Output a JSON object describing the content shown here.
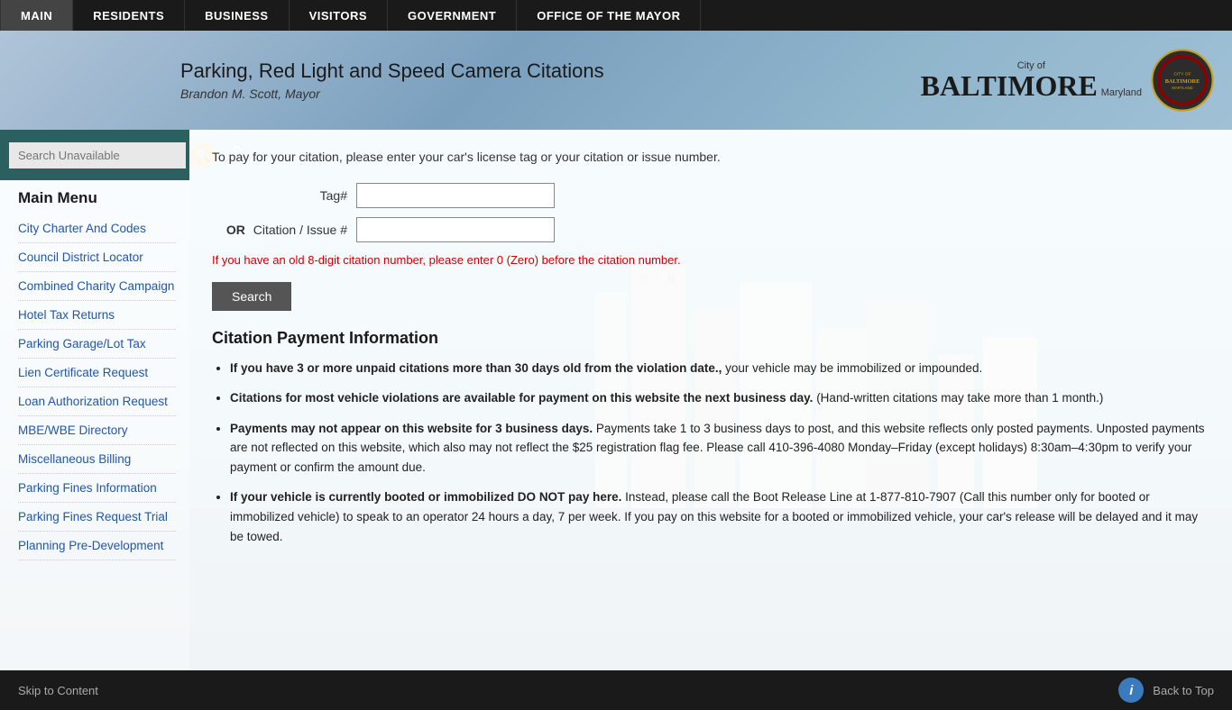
{
  "nav": {
    "items": [
      {
        "label": "MAIN",
        "active": true
      },
      {
        "label": "RESIDENTS",
        "active": false
      },
      {
        "label": "BUSINESS",
        "active": false
      },
      {
        "label": "VISITORS",
        "active": false
      },
      {
        "label": "GOVERNMENT",
        "active": false
      },
      {
        "label": "OFFICE OF THE MAYOR",
        "active": false
      }
    ]
  },
  "header": {
    "title": "Parking, Red Light and Speed Camera Citations",
    "subtitle": "Brandon M. Scott, Mayor",
    "city_of": "City of",
    "city_name": "BALTIMORE",
    "state": "Maryland"
  },
  "sidebar": {
    "search_placeholder": "Search Unavailable",
    "menu_title": "Main Menu",
    "items": [
      {
        "label": "City Charter And Codes"
      },
      {
        "label": "Council District Locator"
      },
      {
        "label": "Combined Charity Campaign"
      },
      {
        "label": "Hotel Tax Returns"
      },
      {
        "label": "Parking Garage/Lot Tax"
      },
      {
        "label": "Lien Certificate Request"
      },
      {
        "label": "Loan Authorization Request"
      },
      {
        "label": "MBE/WBE Directory"
      },
      {
        "label": "Miscellaneous Billing"
      },
      {
        "label": "Parking Fines Information"
      },
      {
        "label": "Parking Fines Request Trial"
      },
      {
        "label": "Planning Pre-Development"
      }
    ]
  },
  "form": {
    "intro": "To pay for your citation, please enter your car's license tag or your citation or issue number.",
    "tag_label": "Tag#",
    "or_label": "OR",
    "citation_label": "Citation / Issue #",
    "hint": "If you have an old 8-digit citation number, please enter 0 (Zero) before the citation number.",
    "search_button": "Search"
  },
  "citation_info": {
    "title": "Citation Payment Information",
    "items": [
      {
        "bold": "If you have 3 or more unpaid citations more than 30 days old from the violation date.,",
        "text": " your vehicle may be immobilized or impounded."
      },
      {
        "bold": "Citations for most vehicle violations are available for payment on this website the next business day.",
        "text": " (Hand-written citations may take more than 1 month.)"
      },
      {
        "bold": "Payments may not appear on this website for 3 business days.",
        "text": " Payments take 1 to 3 business days to post, and this website reflects only posted payments. Unposted payments are not reflected on this website, which also may not reflect the $25 registration flag fee. Please call 410-396-4080 Monday–Friday (except holidays) 8:30am–4:30pm to verify your payment or confirm the amount due."
      },
      {
        "bold": "If your vehicle is currently booted or immobilized DO NOT pay here.",
        "text": " Instead, please call the Boot Release Line at 1-877-810-7907 (Call this number only for booted or immobilized vehicle) to speak to an operator 24 hours a day, 7 per week. If you pay on this website for a booted or immobilized vehicle, your car's release will be delayed and it may be towed."
      }
    ]
  },
  "footer": {
    "skip_label": "Skip to Content",
    "info_icon": "i",
    "back_to_top": "Back to Top"
  }
}
